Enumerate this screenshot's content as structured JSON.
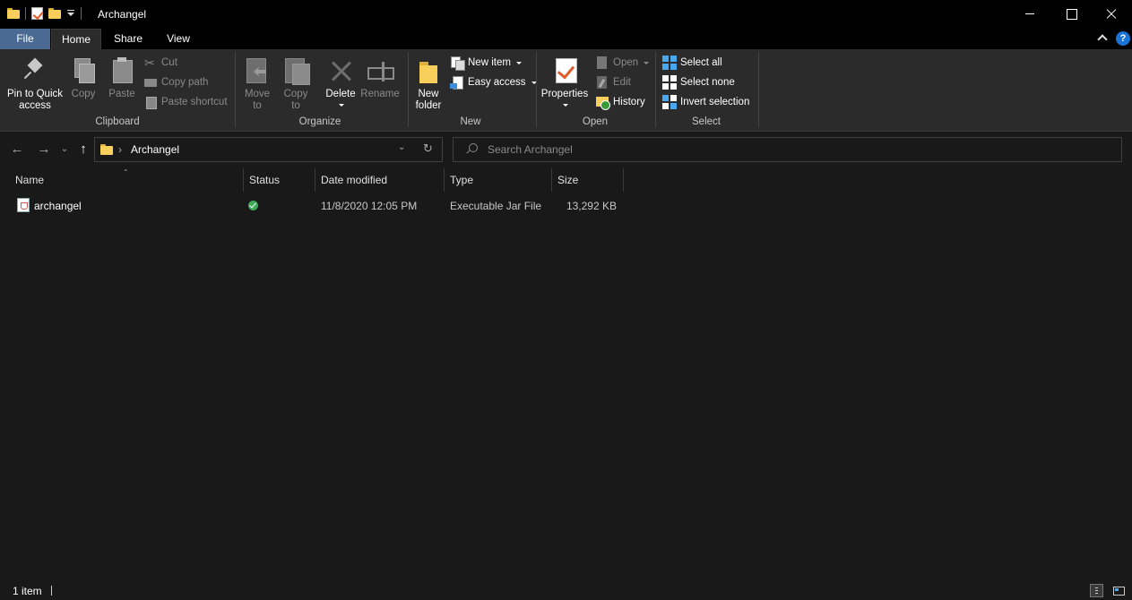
{
  "window": {
    "title": "Archangel"
  },
  "ribbon_tabs": [
    {
      "label": "File"
    },
    {
      "label": "Home"
    },
    {
      "label": "Share"
    },
    {
      "label": "View"
    }
  ],
  "help_glyph": "?",
  "groups": {
    "clipboard": {
      "label": "Clipboard",
      "pin_line1": "Pin to Quick",
      "pin_line2": "access",
      "copy": "Copy",
      "paste": "Paste",
      "cut": "Cut",
      "copy_path": "Copy path",
      "paste_shortcut": "Paste shortcut"
    },
    "organize": {
      "label": "Organize",
      "move_line1": "Move",
      "move_line2": "to",
      "copy_line1": "Copy",
      "copy_line2": "to",
      "delete": "Delete",
      "rename": "Rename"
    },
    "new": {
      "label": "New",
      "folder_line1": "New",
      "folder_line2": "folder",
      "new_item": "New item",
      "easy_access": "Easy access"
    },
    "open": {
      "label": "Open",
      "properties": "Properties",
      "open": "Open",
      "edit": "Edit",
      "history": "History"
    },
    "select": {
      "label": "Select",
      "select_all": "Select all",
      "select_none": "Select none",
      "invert": "Invert selection"
    }
  },
  "address": {
    "path": "Archangel",
    "search_placeholder": "Search Archangel"
  },
  "columns": [
    "Name",
    "Status",
    "Date modified",
    "Type",
    "Size"
  ],
  "files": [
    {
      "name": "archangel",
      "status": "synced",
      "date_modified": "11/8/2020 12:05 PM",
      "type": "Executable Jar File",
      "size": "13,292 KB"
    }
  ],
  "status_bar": {
    "item_count": "1 item"
  },
  "colors": {
    "file_tab": "#4a6a93",
    "status_ok": "#3fa95a",
    "folder": "#f7cf5a"
  }
}
